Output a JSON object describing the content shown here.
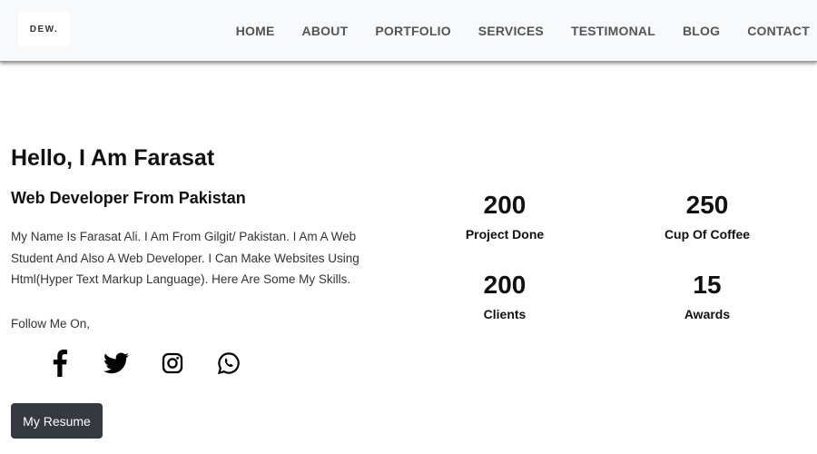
{
  "navbar": {
    "logo": "DEW.",
    "links": [
      "HOME",
      "ABOUT",
      "PORTFOLIO",
      "SERVICES",
      "TESTIMONAL",
      "BLOG",
      "CONTACT"
    ]
  },
  "hero": {
    "title": "Hello, I Am Farasat",
    "subtitle": "Web Developer From Pakistan",
    "description": "My Name Is Farasat Ali. I Am From Gilgit/ Pakistan. I Am A Web Student And Also A Web Developer. I Can Make Websites Using Html(Hyper Text Markup Language). Here Are Some My Skills.",
    "follow_label": "Follow Me On,",
    "socials": [
      "facebook-icon",
      "twitter-icon",
      "instagram-icon",
      "whatsapp-icon"
    ],
    "resume_button": "My Resume"
  },
  "stats": [
    {
      "value": "200",
      "label": "Project Done"
    },
    {
      "value": "250",
      "label": "Cup Of Coffee"
    },
    {
      "value": "200",
      "label": "Clients"
    },
    {
      "value": "15",
      "label": "Awards"
    }
  ]
}
